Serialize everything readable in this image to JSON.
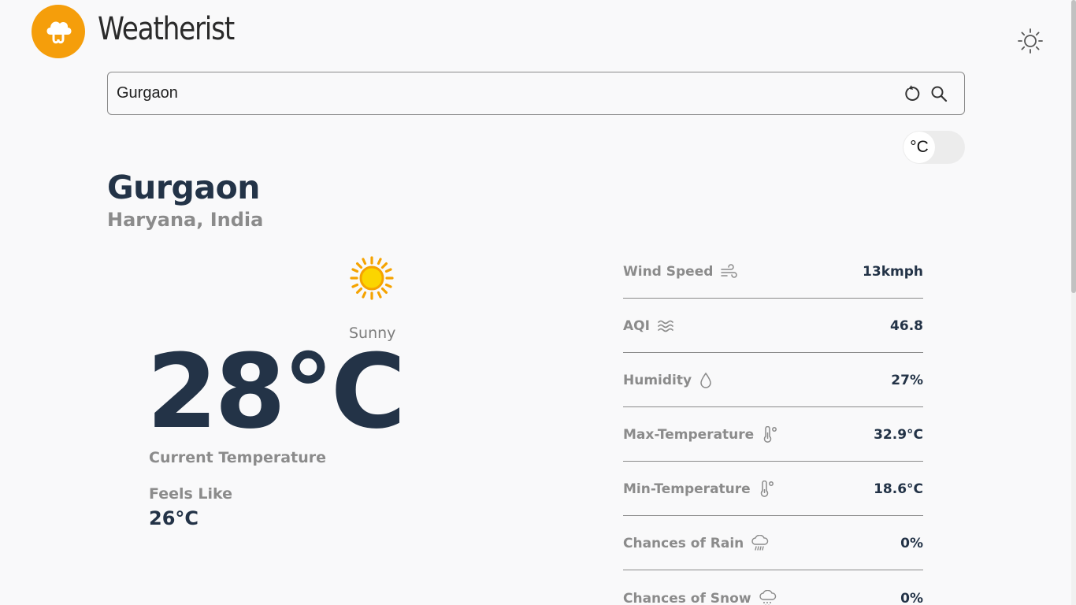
{
  "app": {
    "title": "Weatherist",
    "logo_icon": "cloud-logo-icon",
    "theme_icon": "sun-outline-icon",
    "accent_color": "#f59e0b"
  },
  "search": {
    "value": "Gurgaon",
    "placeholder": "",
    "reset_icon": "refresh-icon",
    "search_icon": "search-icon"
  },
  "unit_toggle": {
    "label": "°C"
  },
  "location": {
    "city": "Gurgaon",
    "region": "Haryana, India"
  },
  "current": {
    "condition": "Sunny",
    "condition_icon": "sun-icon",
    "temperature": "28°C",
    "temperature_label": "Current Temperature",
    "feels_like_label": "Feels Like",
    "feels_like_value": "26°C"
  },
  "details": [
    {
      "label": "Wind Speed",
      "value": "13kmph",
      "icon": "wind-icon"
    },
    {
      "label": "AQI",
      "value": "46.8",
      "icon": "waves-icon"
    },
    {
      "label": "Humidity",
      "value": "27%",
      "icon": "droplet-icon"
    },
    {
      "label": "Max-Temperature",
      "value": "32.9°C",
      "icon": "thermometer-icon"
    },
    {
      "label": "Min-Temperature",
      "value": "18.6°C",
      "icon": "thermometer-icon"
    },
    {
      "label": "Chances of Rain",
      "value": "0%",
      "icon": "rain-cloud-icon"
    },
    {
      "label": "Chances of Snow",
      "value": "0%",
      "icon": "snow-cloud-icon"
    }
  ]
}
